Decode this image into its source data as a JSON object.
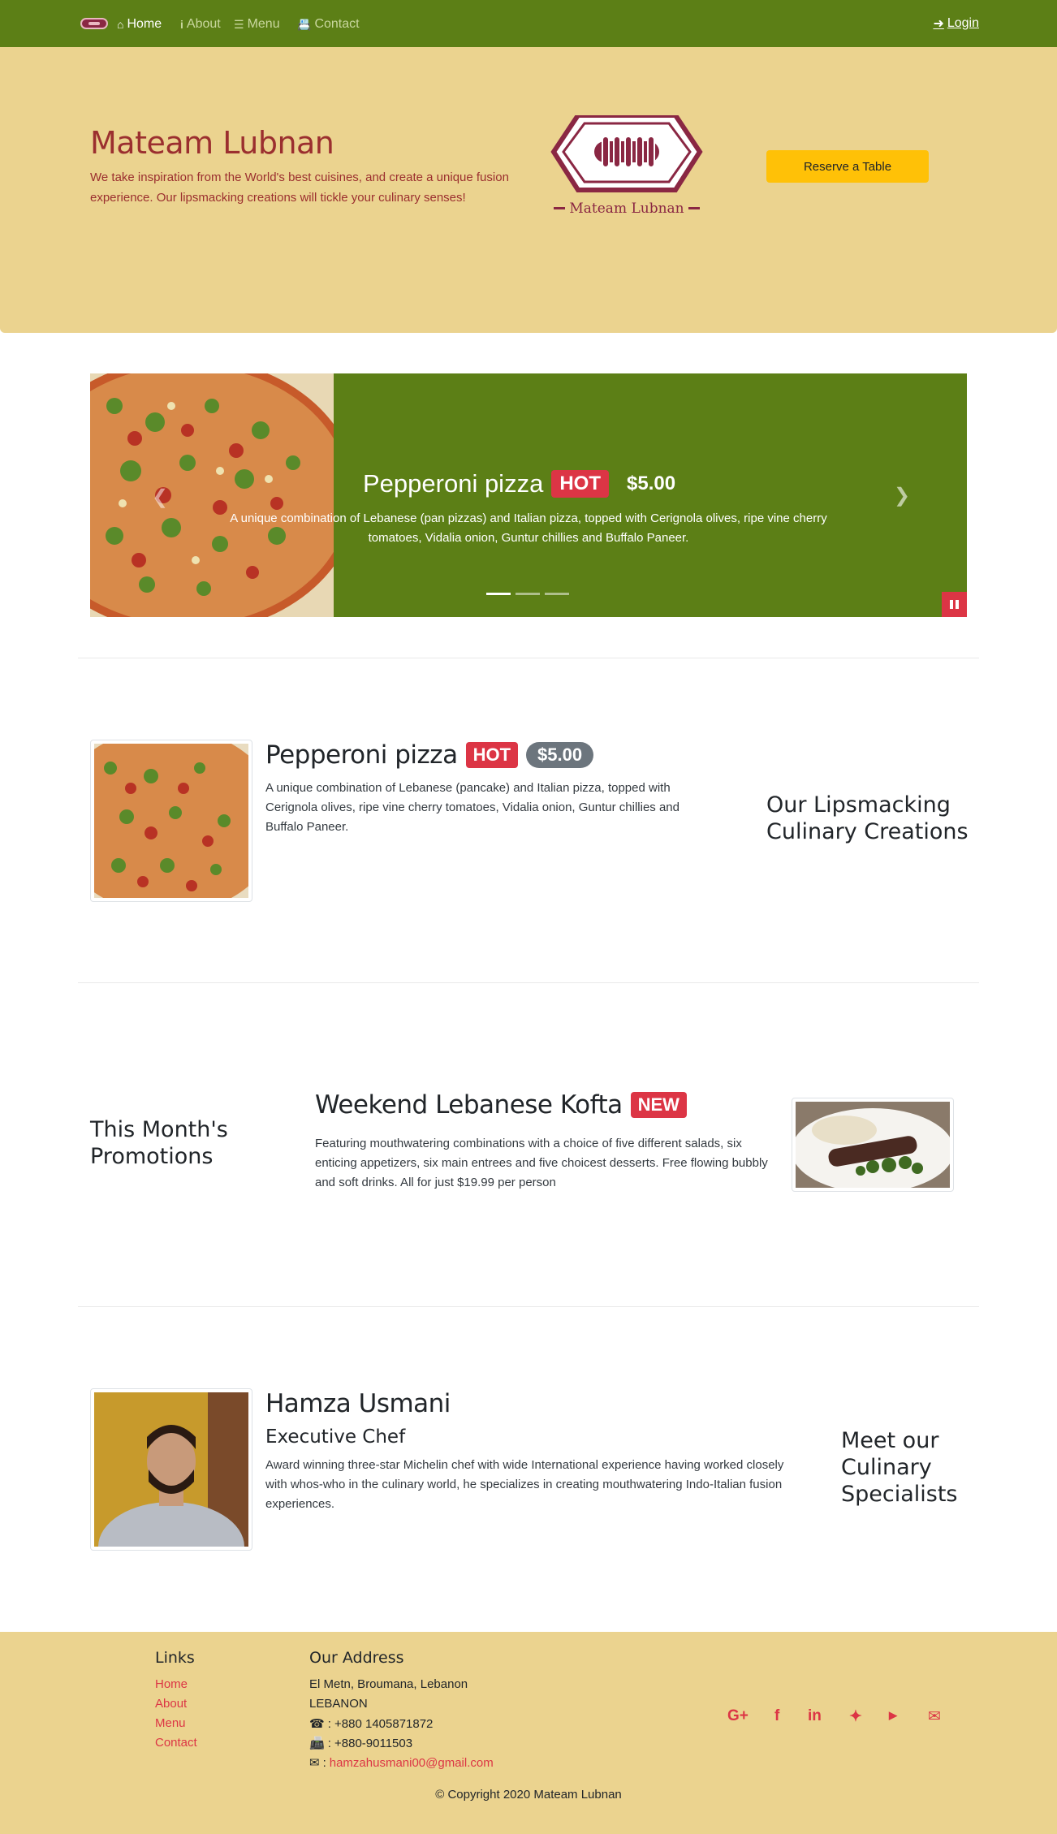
{
  "nav": {
    "home": "Home",
    "about": "About",
    "menu": "Menu",
    "contact": "Contact",
    "login": "Login"
  },
  "jumbotron": {
    "title": "Mateam Lubnan",
    "tagline": "We take inspiration from the World's best cuisines, and create a unique fusion experience. Our lipsmacking creations will tickle your culinary senses!",
    "logo_text": "Mateam Lubnan",
    "reserve_label": "Reserve a Table"
  },
  "carousel": {
    "title": "Pepperoni pizza",
    "badge": "HOT",
    "price": "$5.00",
    "description": "A unique combination of Lebanese (pan pizzas) and Italian pizza, topped with Cerignola olives, ripe vine cherry tomatoes, Vidalia onion, Guntur chillies and Buffalo Paneer.",
    "indicator_count": 3,
    "active_index": 0
  },
  "dish": {
    "title": "Pepperoni pizza",
    "badge": "HOT",
    "price": "$5.00",
    "description": "A unique combination of Lebanese (pancake) and Italian pizza, topped with Cerignola olives, ripe vine cherry tomatoes, Vidalia onion, Guntur chillies and Buffalo Paneer.",
    "section_heading": "Our Lipsmacking Culinary Creations"
  },
  "promotion": {
    "section_heading": "This Month's Promotions",
    "title": "Weekend Lebanese Kofta",
    "badge": "NEW",
    "description": "Featuring mouthwatering combinations with a choice of five different salads, six enticing appetizers, six main entrees and five choicest desserts. Free flowing bubbly and soft drinks. All for just $19.99 per person"
  },
  "chef": {
    "name": "Hamza Usmani",
    "role": "Executive Chef",
    "description": "Award winning three-star Michelin chef with wide International experience having worked closely with whos-who in the culinary world, he specializes in creating mouthwatering Indo-Italian fusion experiences.",
    "section_heading": "Meet our Culinary Specialists"
  },
  "footer": {
    "links_heading": "Links",
    "links": [
      "Home",
      "About",
      "Menu",
      "Contact"
    ],
    "address_heading": "Our Address",
    "address_line1": "El Metn, Broumana, Lebanon",
    "address_line2": "LEBANON",
    "phone": ": +880 1405871872",
    "fax": ": +880-9011503",
    "email": "hamzahusmani00@gmail.com",
    "copyright": "© Copyright 2020 Mateam Lubnan"
  },
  "colors": {
    "navbar": "#5c7f16",
    "jumbotron": "#ebd38f",
    "brand_text": "#9b2f2f",
    "accent": "#dc3545",
    "button": "#ffc107"
  }
}
